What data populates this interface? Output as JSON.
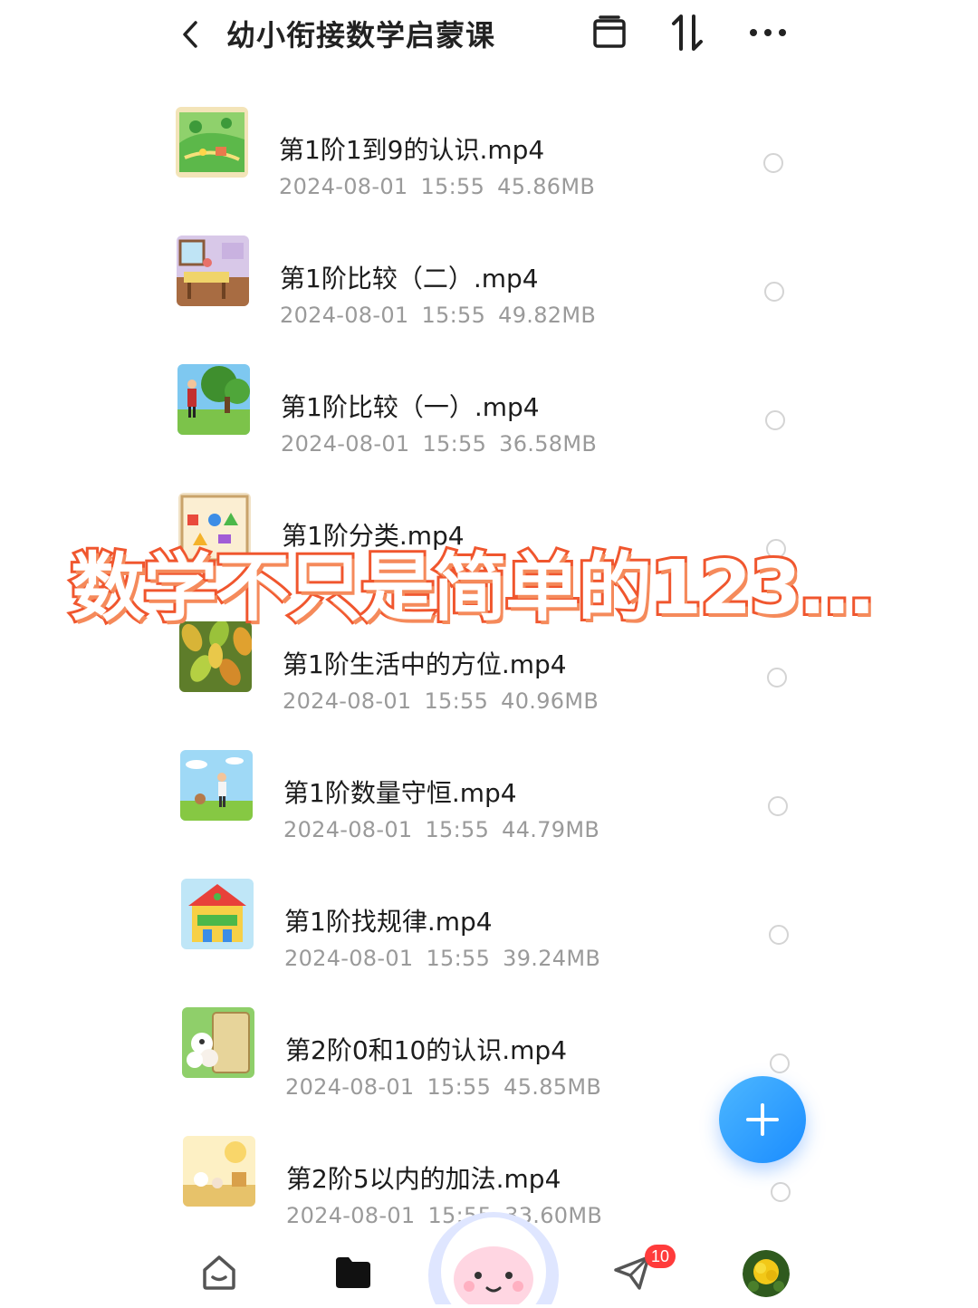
{
  "header": {
    "title": "幼小衔接数学启蒙课",
    "icons": [
      "back-chevron-icon",
      "window-icon",
      "sort-icon",
      "more-icon"
    ]
  },
  "files": [
    {
      "name": "第1阶1到9的认识.mp4",
      "date": "2024-08-01",
      "time": "15:55",
      "size": "45.86MB",
      "thumb": "map-scene"
    },
    {
      "name": "第1阶比较（二）.mp4",
      "date": "2024-08-01",
      "time": "15:55",
      "size": "49.82MB",
      "thumb": "room-scene"
    },
    {
      "name": "第1阶比较（一）.mp4",
      "date": "2024-08-01",
      "time": "15:55",
      "size": "36.58MB",
      "thumb": "forest-scene"
    },
    {
      "name": "第1阶分类.mp4",
      "date": "",
      "time": "",
      "size": "",
      "thumb": "shapes-scene"
    },
    {
      "name": "第1阶生活中的方位.mp4",
      "date": "2024-08-01",
      "time": "15:55",
      "size": "40.96MB",
      "thumb": "leaves-scene"
    },
    {
      "name": "第1阶数量守恒.mp4",
      "date": "2024-08-01",
      "time": "15:55",
      "size": "44.79MB",
      "thumb": "sky-scene"
    },
    {
      "name": "第1阶找规律.mp4",
      "date": "2024-08-01",
      "time": "15:55",
      "size": "39.24MB",
      "thumb": "carnival-scene"
    },
    {
      "name": "第2阶0和10的认识.mp4",
      "date": "2024-08-01",
      "time": "15:55",
      "size": "45.85MB",
      "thumb": "sheep-scene"
    },
    {
      "name": "第2阶5以内的加法.mp4",
      "date": "2024-08-01",
      "time": "15:55",
      "size": "33.60MB",
      "thumb": "yellow-scene"
    }
  ],
  "overlay_text": "数学不只是简单的123…",
  "fab": {
    "icon": "plus-icon"
  },
  "bottom_nav": {
    "items": [
      "home-icon",
      "folder-icon",
      "mascot-avatar",
      "send-icon",
      "profile-avatar"
    ],
    "badge_count": "10"
  },
  "colors": {
    "accent": "#1a8cff",
    "overlay_stroke": "#f0562e",
    "badge": "#ff3b3b",
    "meta_text": "#9a9a9a"
  }
}
